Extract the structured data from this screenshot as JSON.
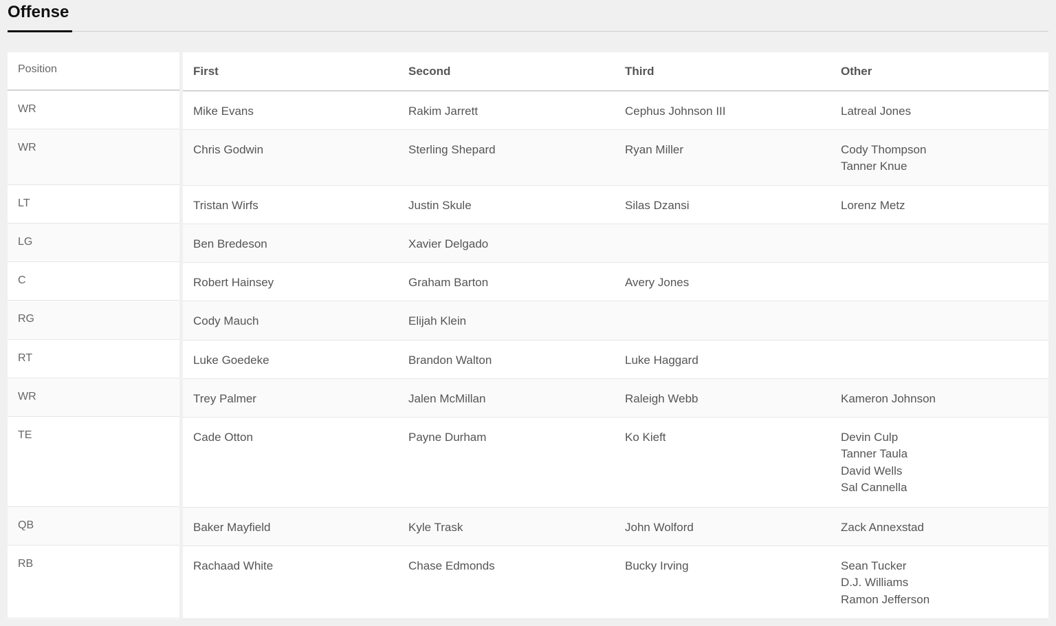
{
  "header": {
    "title": "Offense"
  },
  "table": {
    "columns": {
      "position": "Position",
      "first": "First",
      "second": "Second",
      "third": "Third",
      "other": "Other"
    },
    "rows": [
      {
        "position": "WR",
        "first": "Mike Evans",
        "second": "Rakim Jarrett",
        "third": "Cephus Johnson III",
        "other": [
          "Latreal Jones"
        ]
      },
      {
        "position": "WR",
        "first": "Chris Godwin",
        "second": "Sterling Shepard",
        "third": "Ryan Miller",
        "other": [
          "Cody Thompson",
          "Tanner Knue"
        ]
      },
      {
        "position": "LT",
        "first": "Tristan Wirfs",
        "second": "Justin Skule",
        "third": "Silas Dzansi",
        "other": [
          "Lorenz Metz"
        ]
      },
      {
        "position": "LG",
        "first": "Ben Bredeson",
        "second": "Xavier Delgado",
        "third": "",
        "other": []
      },
      {
        "position": "C",
        "first": "Robert Hainsey",
        "second": "Graham Barton",
        "third": "Avery Jones",
        "other": []
      },
      {
        "position": "RG",
        "first": "Cody Mauch",
        "second": "Elijah Klein",
        "third": "",
        "other": []
      },
      {
        "position": "RT",
        "first": "Luke Goedeke",
        "second": "Brandon Walton",
        "third": "Luke Haggard",
        "other": []
      },
      {
        "position": "WR",
        "first": "Trey Palmer",
        "second": "Jalen McMillan",
        "third": "Raleigh Webb",
        "other": [
          "Kameron Johnson"
        ]
      },
      {
        "position": "TE",
        "first": "Cade Otton",
        "second": "Payne Durham",
        "third": "Ko Kieft",
        "other": [
          "Devin Culp",
          "Tanner Taula",
          "David Wells",
          "Sal Cannella"
        ]
      },
      {
        "position": "QB",
        "first": "Baker Mayfield",
        "second": "Kyle Trask",
        "third": "John Wolford",
        "other": [
          "Zack Annexstad"
        ]
      },
      {
        "position": "RB",
        "first": "Rachaad White",
        "second": "Chase Edmonds",
        "third": "Bucky Irving",
        "other": [
          "Sean Tucker",
          "D.J. Williams",
          "Ramon Jefferson"
        ]
      }
    ]
  }
}
